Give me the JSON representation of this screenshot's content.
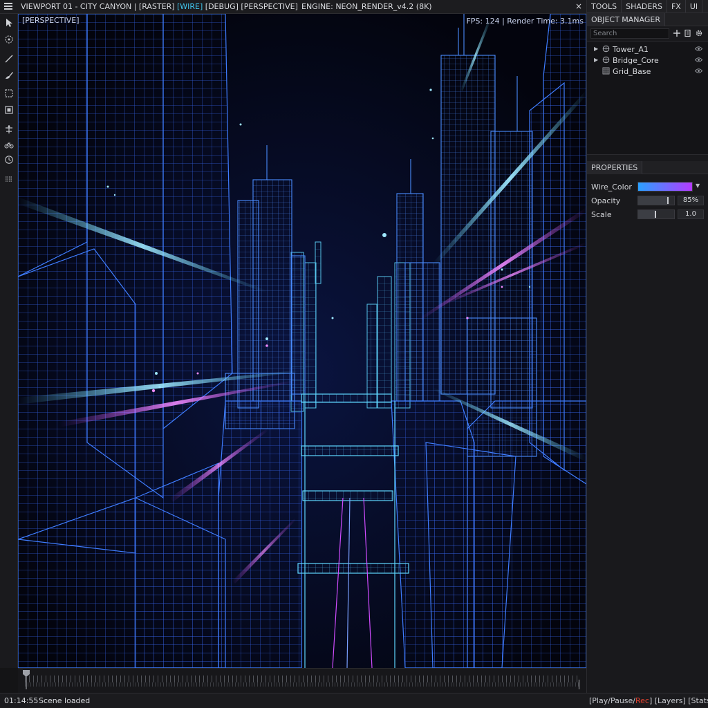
{
  "topbar": {
    "title_pre": "VIEWPORT 01 - CITY CANYON | [RASTER] ",
    "title_hl": "[WIRE]",
    "title_post": " [DEBUG] [PERSPECTIVE]",
    "engine": "ENGINE: NEON_RENDER_v4.2 (8K)",
    "close": "×"
  },
  "toolbar": {
    "tools": [
      "pointer-icon",
      "orbit-icon",
      "line-icon",
      "brush-icon",
      "marquee-icon",
      "frame-icon",
      "transform-icon",
      "bike-icon",
      "history-icon",
      "settings-grid-icon"
    ]
  },
  "viewport": {
    "label": "[PERSPECTIVE]",
    "stats": "FPS: 124 | Render Time: 3.1ms"
  },
  "panel": {
    "tabs": [
      "TOOLS",
      "SHADERS",
      "FX",
      "UI"
    ],
    "object_manager": {
      "title": "OBJECT MANAGER",
      "search_placeholder": "Search",
      "items": [
        {
          "name": "Tower_A1",
          "expandable": true
        },
        {
          "name": "Bridge_Core",
          "expandable": true
        },
        {
          "name": "Grid_Base",
          "expandable": false
        }
      ]
    },
    "properties": {
      "title": "PROPERTIES",
      "wire_color_label": "Wire_Color",
      "wire_color_from": "#2aa0ff",
      "wire_color_to": "#b43bff",
      "opacity_label": "Opacity",
      "opacity_value": "85%",
      "opacity_fraction": 0.85,
      "scale_label": "Scale",
      "scale_value": "1.0",
      "scale_fraction": 0.5
    }
  },
  "status": {
    "time": "01:14:55",
    "message": "Scene loaded",
    "controls_pre": "[Play/Pause/",
    "controls_rec": "Rec",
    "controls_post": "]  [Layers]  [Stats]"
  },
  "colors": {
    "accent": "#41c7ef",
    "wire_blue": "#3f7dff",
    "wire_cyan": "#5fd8ff",
    "wire_magenta": "#d04cff",
    "record": "#e0412f"
  }
}
